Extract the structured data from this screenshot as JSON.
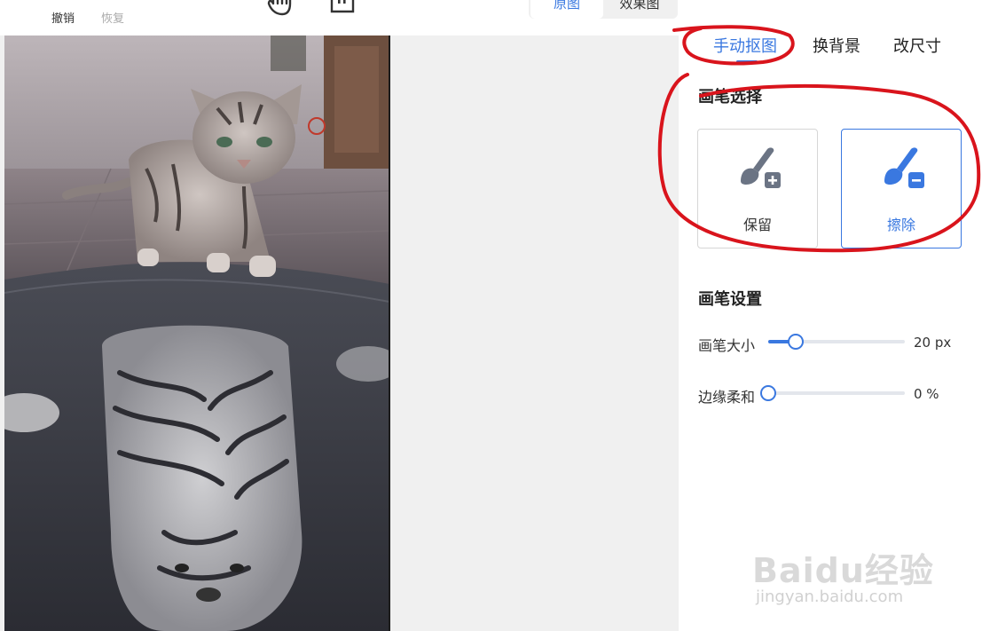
{
  "toolbar": {
    "undo_label": "撤销",
    "redo_label": "恢复",
    "view_original": "原图",
    "view_result": "效果图"
  },
  "panel": {
    "tabs": [
      "手动抠图",
      "换背景",
      "改尺寸"
    ],
    "active_tab": "手动抠图",
    "brush_select_title": "画笔选择",
    "brush_options": [
      {
        "label": "保留",
        "selected": false
      },
      {
        "label": "擦除",
        "selected": true
      }
    ],
    "brush_settings_title": "画笔设置",
    "sliders": [
      {
        "label": "画笔大小",
        "value_text": "20 px",
        "level": 0.2
      },
      {
        "label": "边缘柔和",
        "value_text": "0 %",
        "level": 0
      }
    ]
  },
  "watermark": {
    "logo": "Baidu经验",
    "url": "jingyan.baidu.com"
  },
  "colors": {
    "accent": "#3a78e0",
    "annotation": "#d9141c",
    "canvas_bg": "#f0f0f0"
  }
}
